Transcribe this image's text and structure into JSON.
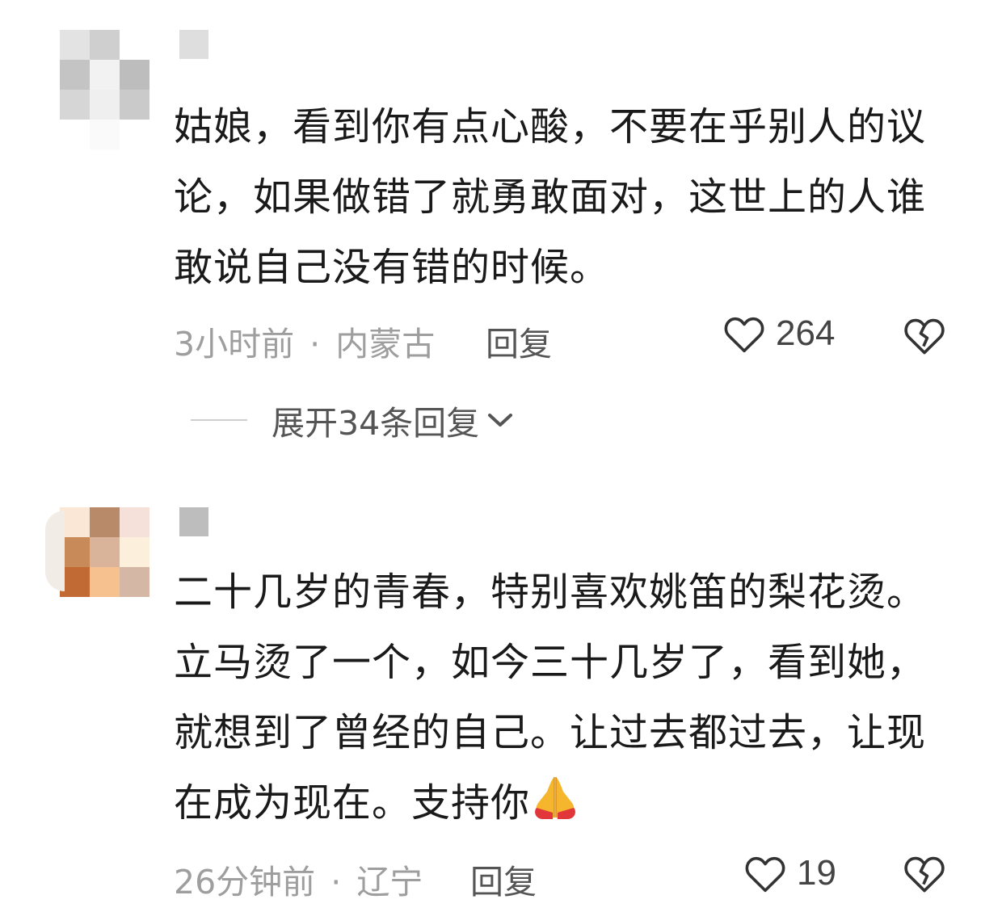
{
  "comments": [
    {
      "text": "姑娘，看到你有点心酸，不要在乎别人的议论，如果做错了就勇敢面对，这世上的人谁敢说自己没有错的时候。",
      "time": "3小时前",
      "separator": "·",
      "location": "内蒙古",
      "reply_label": "回复",
      "like_count": "264",
      "avatar_colors": [
        "#e9e9e9",
        "#c8c8c8",
        "#f4f4f4",
        "#d9d9d9",
        "#b7b7b7",
        "#dcdcdc",
        "#ececec",
        "#fafafa"
      ]
    },
    {
      "text": "二十几岁的青春，特别喜欢姚笛的梨花烫。立马烫了一个，如今三十几岁了，看到她，就想到了曾经的自己。让过去都过去，让现在成为现在。支持你",
      "emoji_icon": "praying-hands-icon",
      "time": "26分钟前",
      "separator": "·",
      "location": "辽宁",
      "reply_label": "回复",
      "like_count": "19",
      "avatar_colors": [
        "#fbe7d6",
        "#b98a6a",
        "#f6e1da",
        "#c98a5a",
        "#d9b49b",
        "#fcefdc",
        "#c26a33",
        "#f6c08f",
        "#d4b8a5"
      ]
    }
  ],
  "expand_replies": {
    "label": "展开34条回复"
  },
  "colors": {
    "text_main": "#1a1a1a",
    "text_meta": "#9e9e9e",
    "icon": "#333333"
  }
}
